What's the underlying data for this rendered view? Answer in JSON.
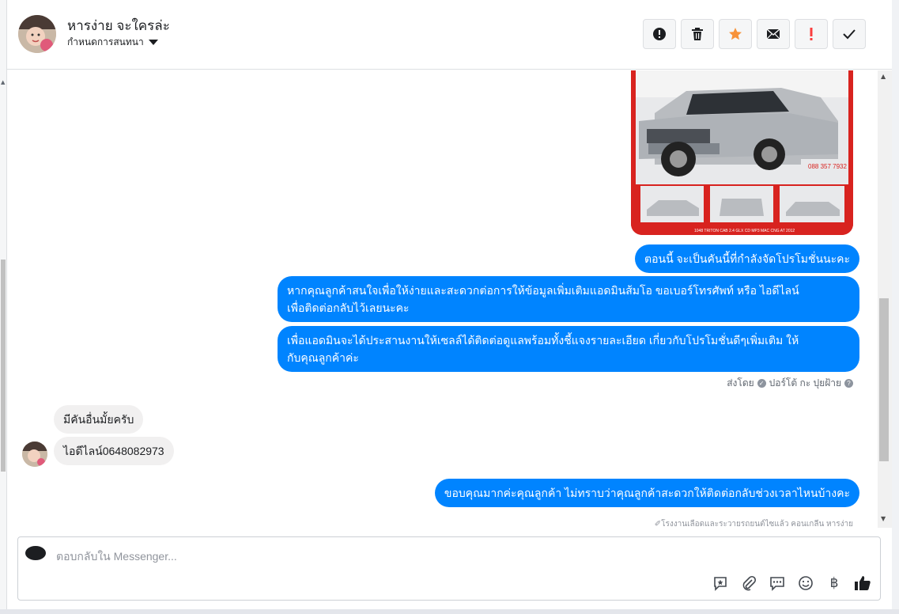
{
  "header": {
    "contact_name": "หารง่าย จะใครล่ะ",
    "assign_label": "กำหนดการสนทนา"
  },
  "toolbar": {
    "buttons": [
      {
        "icon": "alert-circle-icon"
      },
      {
        "icon": "trash-icon"
      },
      {
        "icon": "star-icon",
        "color": "#f7923a"
      },
      {
        "icon": "mail-icon"
      },
      {
        "icon": "spam-exclamation-icon",
        "color": "#fa3e3e"
      },
      {
        "icon": "check-icon"
      }
    ]
  },
  "car_image": {
    "phone": "088 357 7932",
    "caption": "1048 TRITON CAB 2.4 GLX CD MP3 MAC CNG AT 2012"
  },
  "messages": {
    "out_1": "ตอนนี้ จะเป็นคันนี้ที่กำลังจัดโปรโมชั่นนะคะ",
    "out_2_line1": "หากคุณลูกค้าสนใจเพื่อให้ง่ายและสะดวกต่อการให้ข้อมูลเพิ่มเติมแอดมินส้มโอ ขอเบอร์โทรศัพท์ หรือ ไอดีไลน์",
    "out_2_line2": "เพื่อติดต่อกลับไว้เลยนะคะ",
    "out_3_line1": "เพื่อแอดมินจะได้ประสานงานให้เซลล์ได้ติดต่อดูแลพร้อมทั้งชี้แจงรายละเอียด เกี่ยวกับโปรโมชั่นดีๆเพิ่มเติม ให้",
    "out_3_line2": "กับคุณลูกค้าค่ะ",
    "sent_by_prefix": "ส่งโดย",
    "sent_by_name": "ปอร์โต้ กะ ปุยฝ้าย",
    "in_1": "มีคันอื่นมั้ยครับ",
    "in_2": "ไอดีไลน์0648082973",
    "out_4": "ขอบคุณมากค่ะคุณลูกค้า ไม่ทราบว่าคุณลูกค้าสะดวกให้ติดต่อกลับช่วงเวลาไหนบ้างคะ",
    "footnote": "✐โรงงานเลือดและระวายรถยนต์ไซแล้ว คอนเกลีน หารง่าย"
  },
  "composer": {
    "placeholder": "ตอบกลับใน Messenger...",
    "tools": [
      "saved-reply-icon",
      "attach-icon",
      "chat-bubble-icon",
      "emoji-icon",
      "baht-icon",
      "thumbs-up-icon"
    ],
    "baht_symbol": "฿"
  },
  "colors": {
    "accent": "#0084ff",
    "incoming_bubble": "#f1f0f0",
    "star": "#f7923a",
    "spam": "#fa3e3e"
  }
}
